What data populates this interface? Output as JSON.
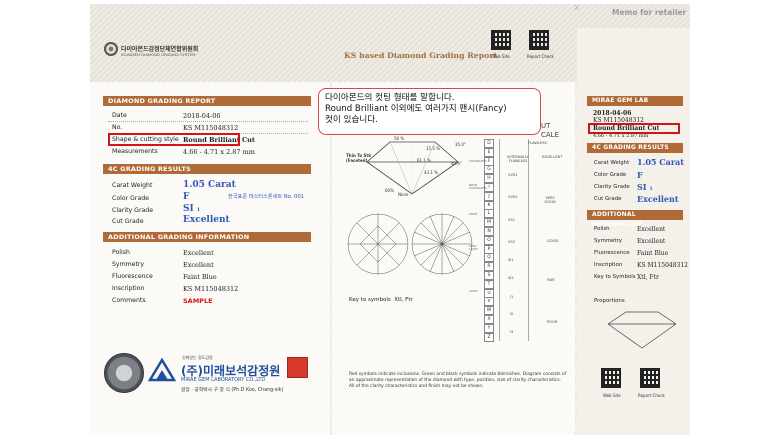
{
  "memo_header": "Memo for retailer",
  "org": {
    "name_kr": "다이아몬드감정단체연합위원회",
    "name_en": "KS-BASED DIAMOND GRADING SYSTEM"
  },
  "report_title": "KS based Diamond Grading Report",
  "qr_labels": {
    "web": "Web Site",
    "check": "Report Check"
  },
  "grading_report": {
    "title": "DIAMOND GRADING REPORT",
    "rows": [
      {
        "label": "Date",
        "value": "2018-04-06"
      },
      {
        "label": "No.",
        "value": "KS M115048312"
      },
      {
        "label": "Shape & cutting style",
        "value": "Round Brilliant Cut"
      },
      {
        "label": "Measurements",
        "value": "4.66 - 4.71 x 2.87 mm"
      }
    ]
  },
  "grading_results": {
    "title": "4C GRADING RESULTS",
    "carat_label": "Carat Weight",
    "carat": "1.05 Carat",
    "color_label": "Color Grade",
    "color": "F",
    "master_note": "한국표준 마스터스톤세트 No. 001",
    "clarity_label": "Clarity Grade",
    "clarity": "SI",
    "clarity_sub": "1",
    "cut_label": "Cut Grade",
    "cut": "Excellent"
  },
  "additional": {
    "title": "ADDITIONAL GRADING INFORMATION",
    "rows": [
      {
        "label": "Polish",
        "value": "Excellent"
      },
      {
        "label": "Symmetry",
        "value": "Excellent"
      },
      {
        "label": "Fluorescence",
        "value": "Faint Blue"
      },
      {
        "label": "Inscription",
        "value": "KS M115048312"
      },
      {
        "label": "Comments",
        "value": "SAMPLE"
      }
    ]
  },
  "lab": {
    "tagline": "신뢰받는 정도감정",
    "name_kr": "(주)미래보석감정원",
    "name_en": "MIRAE GEM LABORATORY CO.,LTD",
    "director": "원장 · 공학박사 구 창 식 (Ph.D Koo, Chang-sik)"
  },
  "diagram": {
    "table_pct": "56 %",
    "crown_pct": "15.5 %",
    "crown_angle": "35.0°",
    "pavilion_pct": "43.1 %",
    "pavilion_angle": "40.6°",
    "depth_pct": "61.1 %",
    "girdle": "Thin To Stk (Faceted)",
    "culet": "None",
    "ratio": "60%"
  },
  "scale": {
    "header_tail": "UT",
    "header_tail2": "CALE",
    "letters": [
      "D",
      "E",
      "F",
      "G",
      "H",
      "I",
      "J",
      "K",
      "L",
      "M",
      "N",
      "O",
      "P",
      "Q",
      "R",
      "S",
      "T",
      "U",
      "V",
      "W",
      "X",
      "Y",
      "Z"
    ],
    "color_words": [
      "COLORLESS",
      "NEAR COLORLESS",
      "FAINT",
      "VERY LIGHT",
      "LIGHT"
    ],
    "clarity_grades": [
      "FLAWLESS",
      "INTERNALLY FLAWLESS",
      "VVS1",
      "VVS2",
      "VS1",
      "VS2",
      "SI1",
      "SI2",
      "I1",
      "I2",
      "I3"
    ],
    "cut_grades": [
      "EXCELLENT",
      "VERY GOOD",
      "GOOD",
      "FAIR",
      "POOR"
    ]
  },
  "key_to_symbols": {
    "label": "Key to symbols",
    "value": "Xtl,  Ftr"
  },
  "footnote": "Red symbols indicate inclusions. Green and black symbols indicate blemishes. Diagram consists of an approximate representation of the diamond with type, position, size of clarity characteristics. All of the clarity characteristics and finish may not be shown.",
  "callout": {
    "line1": "다이아몬드의 컷팅 형태를 말합니다.",
    "line2": "Round Brilliant 이외에도 여러가지 팬시(Fancy)",
    "line3": "컷이 있습니다."
  },
  "retailer": {
    "title": "MIRAE GEM LAB",
    "date": "2018-04-06",
    "no": "KS M115048312",
    "shape": "Round Brilliant Cut",
    "measure": "4.66 - 4.71 x 2.87 mm",
    "results_title": "4C GRADING RESULTS",
    "carat_label": "Carat Weight",
    "carat": "1.05 Carat",
    "color_label": "Color Grade",
    "color": "F",
    "clarity_label": "Clarity Grade",
    "clarity": "SI",
    "clarity_sub": "1",
    "cut_label": "Cut Grade",
    "cut": "Excellent",
    "add_title": "ADDITIONAL INFORMATION",
    "rows": [
      {
        "label": "Polish",
        "value": "Excellent"
      },
      {
        "label": "Symmetry",
        "value": "Excellent"
      },
      {
        "label": "Fluorescence",
        "value": "Faint Blue"
      },
      {
        "label": "Inscription",
        "value": "KS M115048312"
      },
      {
        "label": "Key to Symbols",
        "value": "Xtl,  Ftr"
      }
    ],
    "proportions_label": "Proportions"
  },
  "colors": {
    "accent": "#b06a37",
    "highlight": "#d3141b",
    "value_blue": "#3057b8"
  }
}
